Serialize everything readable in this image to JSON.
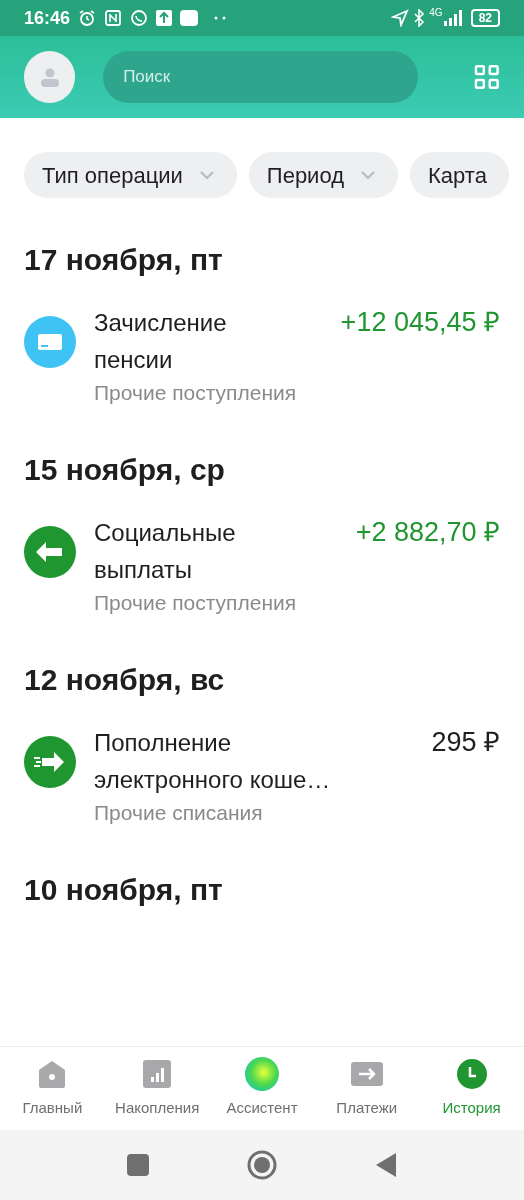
{
  "status_bar": {
    "time": "16:46",
    "network": "4G",
    "battery": "82"
  },
  "header": {
    "search": {
      "placeholder": "Поиск"
    }
  },
  "filters": [
    {
      "label": "Тип операции",
      "dropdown": true
    },
    {
      "label": "Период",
      "dropdown": true
    },
    {
      "label": "Карта",
      "dropdown": false
    }
  ],
  "days": [
    {
      "date": "17 ноября, пт",
      "transactions": [
        {
          "kind": "card",
          "title": "Зачисление\nпенсии",
          "category": "Прочие поступления",
          "amount": "+12 045,45 ₽",
          "color": "#1f962f"
        }
      ]
    },
    {
      "date": "15 ноября, ср",
      "transactions": [
        {
          "kind": "arrow-left",
          "title": "Социальные\nвыплаты",
          "category": "Прочие поступления",
          "amount": "+2 882,70 ₽",
          "color": "#1f962f"
        }
      ]
    },
    {
      "date": "12 ноября, вс",
      "transactions": [
        {
          "kind": "arrow-right",
          "title": "Пополнение\nэлектронного коше…",
          "category": "Прочие списания",
          "amount": "295 ₽",
          "color": "#1f1f22"
        }
      ]
    },
    {
      "date": "10 ноября, пт"
    }
  ],
  "bottom_nav": [
    {
      "kind": "home",
      "label": "Главный",
      "selected": false
    },
    {
      "kind": "savings",
      "label": "Накопления",
      "selected": false
    },
    {
      "kind": "assistant",
      "label": "Ассистент",
      "selected": false
    },
    {
      "kind": "payments",
      "label": "Платежи",
      "selected": false
    },
    {
      "kind": "history",
      "label": "История",
      "selected": true
    }
  ]
}
